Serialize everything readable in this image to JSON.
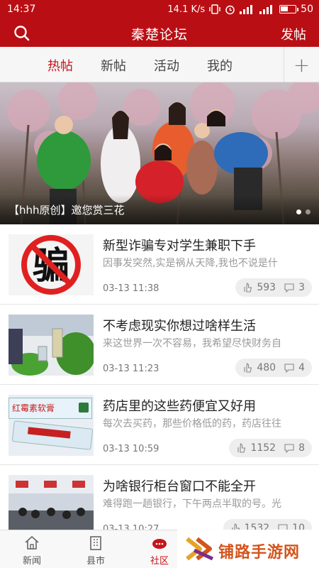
{
  "status_bar": {
    "time": "14:37",
    "speed": "14.1 K/s",
    "battery": "50",
    "battery_level": 0.5
  },
  "app_bar": {
    "title": "秦楚论坛",
    "post_label": "发帖",
    "search_icon": "search-icon"
  },
  "tabs": [
    {
      "label": "热帖",
      "active": true
    },
    {
      "label": "新帖",
      "active": false
    },
    {
      "label": "活动",
      "active": false
    },
    {
      "label": "我的",
      "active": false
    }
  ],
  "tab_add_label": "+",
  "banner": {
    "caption": "【hhh原创】邀您赏三花",
    "slide_count": 2,
    "active_slide": 1
  },
  "news": [
    {
      "title": "新型诈骗专对学生兼职下手",
      "excerpt": "因事发突然,实是祸从天降,我也不说是什",
      "time": "03-13 11:38",
      "views": "593",
      "comments": "3",
      "thumb": "骗"
    },
    {
      "title": "不考虑现实你想过啥样生活",
      "excerpt": "来这世界一次不容易，我希望尽快财务自",
      "time": "03-13 11:23",
      "views": "480",
      "comments": "4"
    },
    {
      "title": "药店里的这些药便宜又好用",
      "excerpt": "每次去买药，那些价格低的药，药店往往",
      "time": "03-13 10:59",
      "views": "1152",
      "comments": "8",
      "thumb_text": "红霉素软膏"
    },
    {
      "title": "为啥银行柜台窗口不能全开",
      "excerpt": "难得跑一趟银行，下午两点半取的号。光",
      "time": "03-13 10:27",
      "views": "1532",
      "comments": "10"
    }
  ],
  "bottom_nav": [
    {
      "label": "新闻",
      "icon": "home-icon",
      "active": false
    },
    {
      "label": "县市",
      "icon": "building-icon",
      "active": false
    },
    {
      "label": "社区",
      "icon": "community-icon",
      "active": true
    }
  ],
  "watermark": {
    "text": "铺路手游网"
  },
  "colors": {
    "brand_red": "#b90f14",
    "accent_red": "#c5141a"
  }
}
